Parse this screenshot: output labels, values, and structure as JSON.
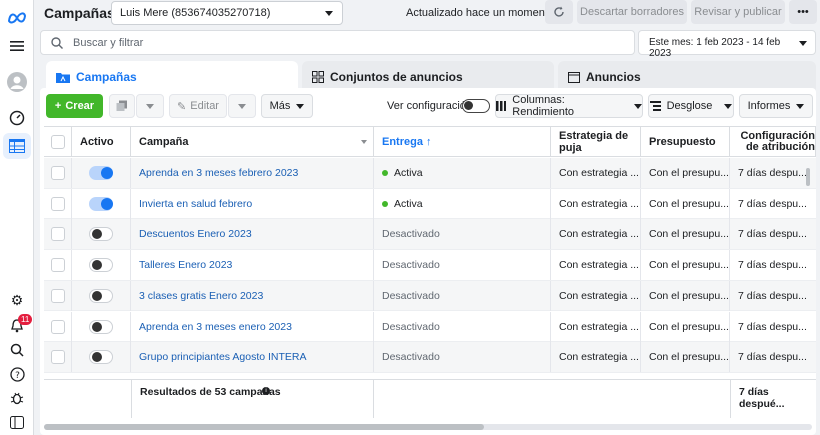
{
  "app": {
    "title": "Campañas"
  },
  "account": {
    "name": "Luis Mere (853674035270718)"
  },
  "header": {
    "updated": "Actualizado hace un momento",
    "discard": "Descartar borradores",
    "review": "Revisar y publicar",
    "more": "•••"
  },
  "search": {
    "placeholder": "Buscar y filtrar"
  },
  "date_range": "Este mes: 1 feb 2023 - 14 feb 2023",
  "tabs": [
    {
      "label": "Campañas",
      "active": true
    },
    {
      "label": "Conjuntos de anuncios",
      "active": false
    },
    {
      "label": "Anuncios",
      "active": false
    }
  ],
  "toolbar": {
    "create": "Crear",
    "edit": "Editar",
    "more": "Más",
    "view_config": "Ver configuración",
    "columns": "Columnas: Rendimiento",
    "breakdown": "Desglose",
    "reports": "Informes"
  },
  "notifications_count": "11",
  "columns": [
    "Activo",
    "Campaña",
    "Entrega ↑",
    "Estrategia de puja",
    "Presupuesto",
    "Configuración de atribución"
  ],
  "rows": [
    {
      "active": true,
      "name": "Aprenda en 3 meses febrero 2023",
      "delivery": "Activa",
      "bid": "Con estrategia ...",
      "budget": "Con el presupu...",
      "attribution": "7 días despu..."
    },
    {
      "active": true,
      "name": "Invierta en salud febrero",
      "delivery": "Activa",
      "bid": "Con estrategia ...",
      "budget": "Con el presupu...",
      "attribution": "7 días despu..."
    },
    {
      "active": false,
      "name": "Descuentos Enero 2023",
      "delivery": "Desactivado",
      "bid": "Con estrategia ...",
      "budget": "Con el presupu...",
      "attribution": "7 días despu..."
    },
    {
      "active": false,
      "name": "Talleres Enero 2023",
      "delivery": "Desactivado",
      "bid": "Con estrategia ...",
      "budget": "Con el presupu...",
      "attribution": "7 días despu..."
    },
    {
      "active": false,
      "name": "3 clases gratis Enero 2023",
      "delivery": "Desactivado",
      "bid": "Con estrategia ...",
      "budget": "Con el presupu...",
      "attribution": "7 días despu..."
    },
    {
      "active": false,
      "name": "Aprenda en 3 meses enero 2023",
      "delivery": "Desactivado",
      "bid": "Con estrategia ...",
      "budget": "Con el presupu...",
      "attribution": "7 días despu..."
    },
    {
      "active": false,
      "name": "Grupo principiantes Agosto INTERA",
      "delivery": "Desactivado",
      "bid": "Con estrategia ...",
      "budget": "Con el presupu...",
      "attribution": "7 días despu..."
    }
  ],
  "footer": {
    "results": "Resultados de 53 campañas",
    "attribution": "7 días despué..."
  },
  "colors": {
    "accent": "#1877f2",
    "create": "#42b72a",
    "active_dot": "#42b72a"
  }
}
